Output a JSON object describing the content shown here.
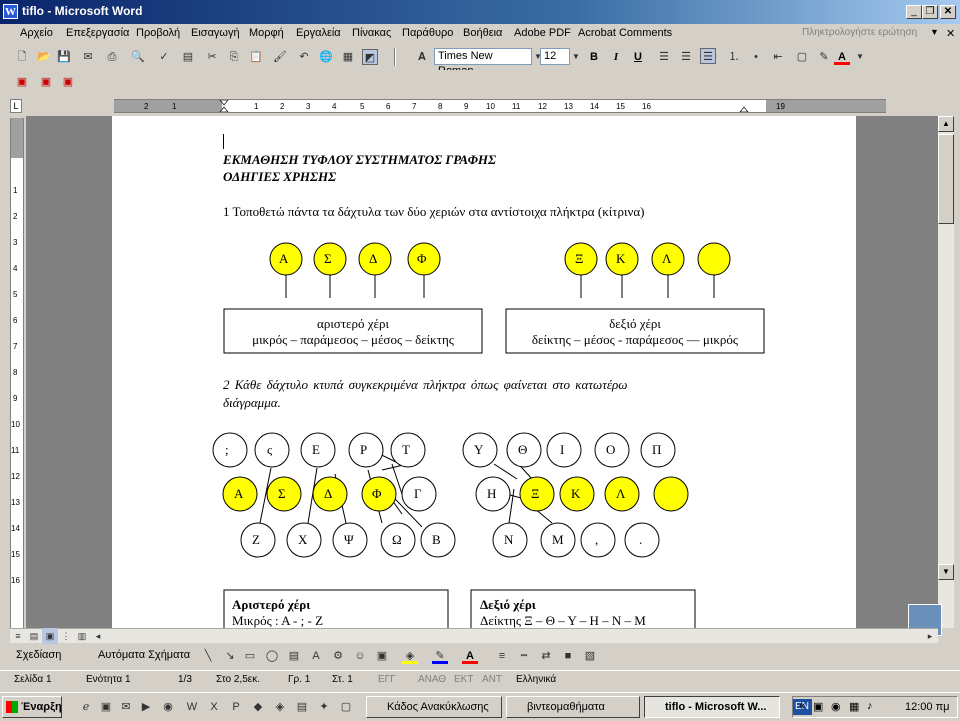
{
  "window": {
    "title": "tiflo - Microsoft Word"
  },
  "menu": {
    "items": [
      "Αρχείο",
      "Επεξεργασία",
      "Προβολή",
      "Εισαγωγή",
      "Μορφή",
      "Εργαλεία",
      "Πίνακας",
      "Παράθυρο",
      "Βοήθεια",
      "Adobe PDF",
      "Acrobat Comments"
    ],
    "help_box": "Πληκτρολογήστε ερώτηση"
  },
  "format": {
    "font": "Times New Roman",
    "size": "12"
  },
  "doc": {
    "heading1": "ΕΚΜΑΘΗΣΗ ΤΥΦΛΟΥ ΣΥΣΤΗΜΑΤΟΣ ΓΡΑΦΗΣ",
    "heading2": "ΟΔΗΓΙΕΣ ΧΡΗΣΗΣ",
    "step1": "1  Τοποθετώ πάντα τα δάχτυλα των δύο χεριών στα αντίστοιχα πλήκτρα (κίτρινα)",
    "left_keys": [
      "Α",
      "Σ",
      "Δ",
      "Φ"
    ],
    "right_keys": [
      "Ξ",
      "Κ",
      "Λ",
      ""
    ],
    "left_box": [
      "αριστερό χέρι",
      "μικρός – παράμεσος – μέσος – δείκτης"
    ],
    "right_box": [
      "δεξιό χέρι",
      "δείκτης – μέσος - παράμεσος — μικρός"
    ],
    "step2_line1": "2  Κάθε  δάχτυλο  κτυπά  συγκεκριμένα  πλήκτρα  όπως  φαίνεται  στο  κατωτέρω",
    "step2_line2": "διάγραμμα.",
    "top_left": [
      ";",
      "ς",
      "Ε",
      "Ρ",
      "Τ"
    ],
    "mid_left": [
      "Α",
      "Σ",
      "Δ",
      "Φ",
      "Γ"
    ],
    "bot_left": [
      "Ζ",
      "Χ",
      "Ψ",
      "Ω",
      "Β"
    ],
    "top_right": [
      "Υ",
      "Θ",
      "Ι",
      "Ο",
      "Π"
    ],
    "mid_right": [
      "Η",
      "Ξ",
      "Κ",
      "Λ",
      ""
    ],
    "bot_right": [
      "Ν",
      "Μ",
      ",",
      "."
    ],
    "left_hand_title": "Αριστερό χέρι",
    "left_hand_text": "Μικρός : Α - ;  - Ζ",
    "right_hand_title": "Δεξιό χέρι",
    "right_hand_text": "Δείκτης   Ξ – Θ – Υ – Η – Ν – Μ"
  },
  "drawing": {
    "draw_label": "Σχεδίαση",
    "autoshapes_label": "Αυτόματα Σχήματα"
  },
  "status": {
    "page": "Σελίδα 1",
    "section": "Ενότητα 1",
    "pages": "1/3",
    "at": "Στο 2,5εκ.",
    "line": "Γρ. 1",
    "col": "Στ. 1",
    "modes": [
      "ΕΓΓ",
      "ΑΝΑΘ",
      "ΕΚΤ",
      "ΑΝΤ"
    ],
    "language": "Ελληνικά"
  },
  "taskbar": {
    "start": "Έναρξη",
    "tasks": [
      "Κάδος Ανακύκλωσης",
      "βιντεομαθήματα",
      "tiflo - Microsoft W..."
    ],
    "lang": "EN",
    "clock": "12:00 πμ"
  },
  "colors": {
    "key_yellow": "#ffff00",
    "title_start": "#0a246a"
  }
}
